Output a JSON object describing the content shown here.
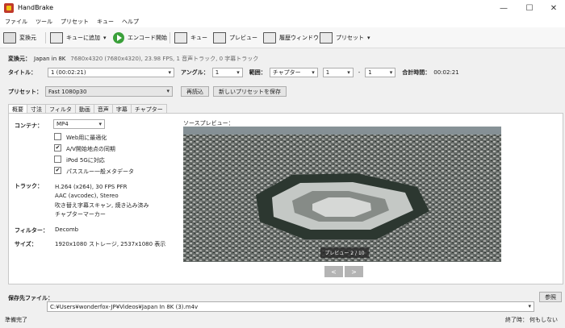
{
  "window": {
    "title": "HandBrake",
    "minimize": "—",
    "maximize": "☐",
    "close": "✕"
  },
  "menu": [
    "ファイル",
    "ツール",
    "プリセット",
    "キュー",
    "ヘルプ"
  ],
  "toolbar": {
    "source": "変換元",
    "add_queue": "キューに追加",
    "start": "エンコード開始",
    "queue": "キュー",
    "preview": "プレビュー",
    "activity": "履歴ウィンドウ",
    "presets": "プリセット"
  },
  "source_info": {
    "label": "変換元：",
    "name": "Japan in 8K",
    "details": "7680x4320 (7680x4320), 23.98 FPS, 1 音声トラック, 0 字幕トラック"
  },
  "title_row": {
    "title_label": "タイトル：",
    "title_value": "1 (00:02:21)",
    "angle_label": "アングル：",
    "angle_value": "1",
    "range_label": "範囲：",
    "range_type": "チャプター",
    "range_start": "1",
    "range_dash": "-",
    "range_end": "1",
    "duration_label": "合計時間：",
    "duration_value": "00:02:21"
  },
  "preset_row": {
    "label": "プリセット：",
    "value": "Fast 1080p30",
    "reload": "再読込",
    "save_new": "新しいプリセットを保存"
  },
  "tabs": [
    "概要",
    "寸法",
    "フィルタ",
    "動画",
    "音声",
    "字幕",
    "チャプター"
  ],
  "summary": {
    "container_label": "コンテナ：",
    "container_value": "MP4",
    "options": [
      {
        "label": "Web用に最適化",
        "checked": false
      },
      {
        "label": "A/V開始地点の同期",
        "checked": true
      },
      {
        "label": "iPod 5Gに対応",
        "checked": false
      },
      {
        "label": "パススルー一般メタデータ",
        "checked": true
      }
    ],
    "tracks_label": "トラック：",
    "tracks": [
      "H.264 (x264), 30 FPS PFR",
      "AAC (avcodec), Stereo",
      "吹き替え字幕スキャン, 焼き込み済み",
      "チャプターマーカー"
    ],
    "filters_label": "フィルター：",
    "filters_value": "Decomb",
    "size_label": "サイズ：",
    "size_value": "1920x1080 ストレージ, 2537x1080 表示"
  },
  "preview": {
    "label": "ソースプレビュー：",
    "counter": "プレビュー 2 / 10",
    "prev": "<",
    "next": ">"
  },
  "destination": {
    "label": "保存先ファイル：",
    "path": "C:¥Users¥wonderfox-JP¥Videos¥Japan In 8K (3).m4v",
    "browse": "参照"
  },
  "status": {
    "left": "準備完了",
    "when_done_label": "終了時：",
    "when_done_value": "何もしない"
  }
}
